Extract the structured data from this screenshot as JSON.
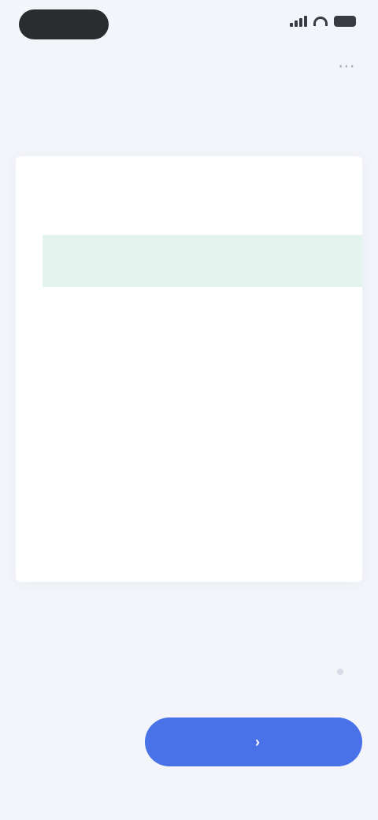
{
  "status_bar": {
    "time": "",
    "icons": [
      "signal-icon",
      "wifi-icon",
      "battery-icon"
    ]
  },
  "header": {
    "title": "",
    "action_icon": "more-icon"
  },
  "card": {
    "paragraphs": [
      "",
      "",
      "",
      "",
      "",
      ""
    ],
    "meta": ""
  },
  "footer": {
    "secondary_label": "",
    "primary_label": "",
    "primary_icon": "arrow-right-icon",
    "accent_color": "#4a72e8"
  }
}
